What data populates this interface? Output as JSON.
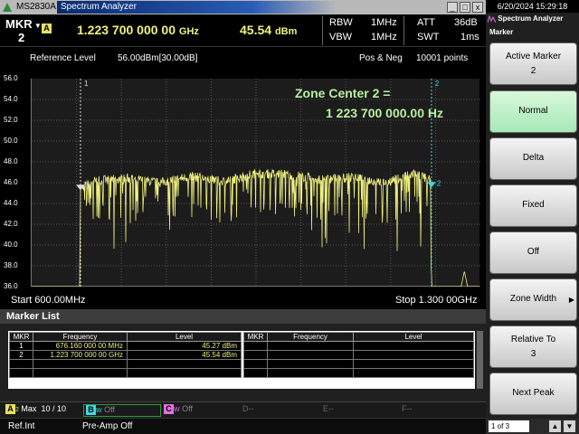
{
  "titlebar": {
    "model": "MS2830A",
    "app": "Spectrum Analyzer",
    "min": "_",
    "max": "□",
    "close": "x"
  },
  "marker_bar": {
    "mkr_label": "MKR",
    "mkr_num": "2",
    "trace": "A",
    "freq": "1.223 700 000 00",
    "freq_unit": "GHz",
    "level": "45.54",
    "level_unit": "dBm",
    "rbw_label": "RBW",
    "rbw": "1MHz",
    "vbw_label": "VBW",
    "vbw": "1MHz",
    "att_label": "ATT",
    "att": "36dB",
    "swt_label": "SWT",
    "swt": "1ms"
  },
  "graph": {
    "ref_label": "Reference Level",
    "ref_value": "56.00dBm[30.00dB]",
    "detector": "Pos & Neg",
    "points": "10001 points",
    "start": "Start 600.00MHz",
    "stop": "Stop 1.300 00GHz",
    "zone_line1": "Zone Center 2 =",
    "zone_line2": "1 223 700 000.00 Hz",
    "m1_tag": "1",
    "m2_tag": "2"
  },
  "chart_data": {
    "type": "line",
    "title": "",
    "xlabel": "",
    "ylabel": "",
    "xlim": [
      600,
      1300
    ],
    "ylim": [
      36,
      56
    ],
    "yticks": [
      "56.0",
      "54.0",
      "52.0",
      "50.0",
      "48.0",
      "46.0",
      "44.0",
      "42.0",
      "40.0",
      "38.0",
      "36.0"
    ],
    "x_unit": "MHz",
    "y_unit": "dBm",
    "series": [
      {
        "x": [
          600,
          675,
          676,
          700,
          750,
          800,
          850,
          900,
          950,
          1000,
          1050,
          1100,
          1150,
          1200,
          1222,
          1224,
          1230,
          1270,
          1275,
          1280,
          1300
        ],
        "values": [
          36,
          36,
          45.5,
          46.2,
          46.4,
          46.0,
          46.6,
          46.1,
          46.9,
          46.8,
          46.3,
          46.5,
          46.0,
          46.9,
          46.2,
          36,
          36,
          36,
          37.5,
          36,
          36
        ]
      }
    ],
    "markers": [
      {
        "id": "1",
        "x": 676.16,
        "y": 45.27
      },
      {
        "id": "2",
        "x": 1223.7,
        "y": 45.54
      }
    ],
    "grid": true
  },
  "marker_list": {
    "title": "Marker List",
    "headers": [
      "MKR",
      "Frequency",
      "Level"
    ],
    "rows": [
      {
        "mkr": "1",
        "freq": "676.160 000 00 MHz",
        "level": "45.27 dBm"
      },
      {
        "mkr": "2",
        "freq": "1.223 700 000 00 GHz",
        "level": "45.54 dBm"
      }
    ]
  },
  "traces": {
    "a": "A",
    "a_mode": "Max",
    "a_count": "10",
    "a_sep": "/",
    "a_total": "10",
    "b": "B",
    "b_w": "W",
    "b_state": "Off",
    "c": "C",
    "c_w": "W",
    "c_state": "Off",
    "d": "D",
    "e": "E",
    "f": "F",
    "dash": "--"
  },
  "status": {
    "ref": "Ref.Int",
    "preamp": "Pre-Amp Off"
  },
  "panel": {
    "datetime": "6/20/2024 15:29:18",
    "app": "Spectrum Analyzer",
    "menu": "Marker",
    "keys": [
      {
        "l1": "Active Marker",
        "l2": "2"
      },
      {
        "l1": "Normal",
        "l2": ""
      },
      {
        "l1": "Delta",
        "l2": ""
      },
      {
        "l1": "Fixed",
        "l2": ""
      },
      {
        "l1": "Off",
        "l2": ""
      },
      {
        "l1": "Zone Width",
        "l2": ""
      },
      {
        "l1": "Relative To",
        "l2": "3"
      },
      {
        "l1": "Next Peak",
        "l2": ""
      }
    ],
    "page": "1 of 3"
  },
  "colors": {
    "trace": "#f0f080",
    "zone": "#b8f0a0",
    "marker_line": "#40d8e0",
    "selected_key": "#b8f0c8"
  }
}
